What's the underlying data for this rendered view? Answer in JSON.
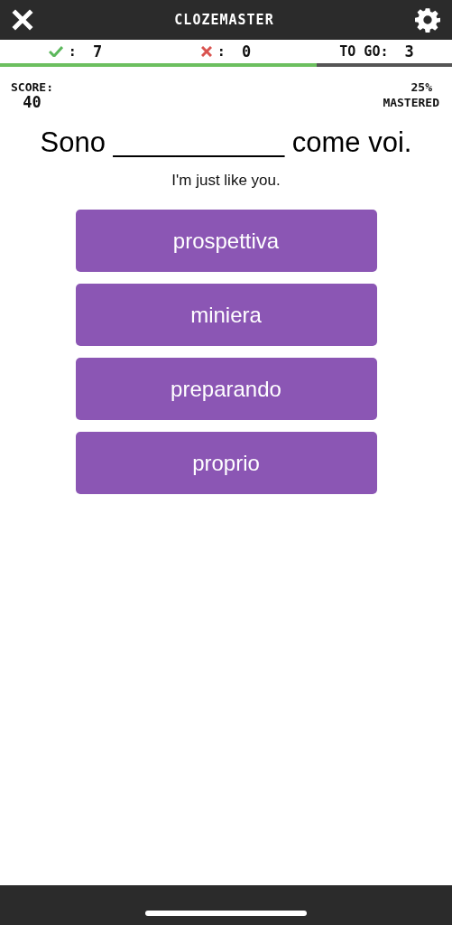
{
  "header": {
    "title": "CLOZEMASTER"
  },
  "stats": {
    "correct_label": ":",
    "correct": "7",
    "wrong_label": ":",
    "wrong": "0",
    "to_go_label": "TO GO:",
    "to_go": "3"
  },
  "progress": {
    "level": 0.7
  },
  "score": {
    "label": "SCORE:",
    "value": "40"
  },
  "mastered": {
    "percent": "25%",
    "label": "MASTERED"
  },
  "sentence": "Sono ___________ come voi.",
  "translation": "I'm just like you.",
  "choices": [
    "prospettiva",
    "miniera",
    "preparando",
    "proprio"
  ]
}
